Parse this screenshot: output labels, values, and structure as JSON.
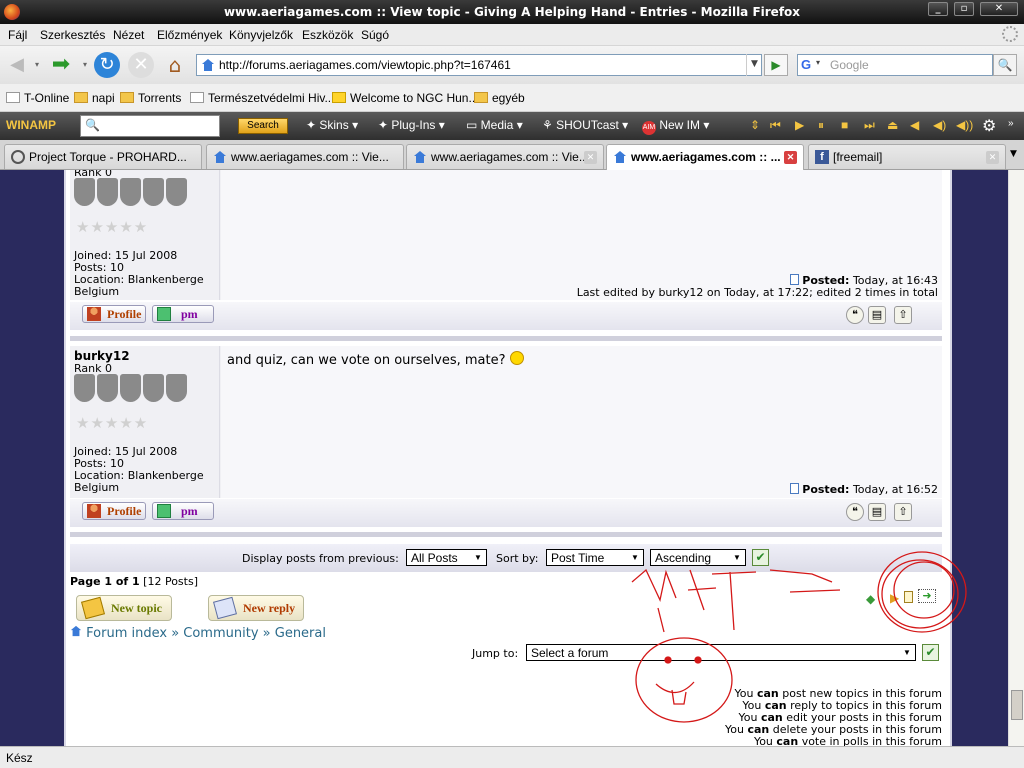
{
  "window": {
    "title": "www.aeriagames.com :: View topic - Giving A Helping Hand - Entries - Mozilla Firefox"
  },
  "menu": [
    "Fájl",
    "Szerkesztés",
    "Nézet",
    "Előzmények",
    "Könyvjelzők",
    "Eszközök",
    "Súgó"
  ],
  "nav": {
    "url": "http://forums.aeriagames.com/viewtopic.php?t=167461",
    "search_placeholder": "Google",
    "search_engine": "G"
  },
  "bookmarks": [
    "T-Online",
    "napi",
    "Torrents",
    "Természetvédelmi Hiv...",
    "Welcome to NGC Hun...",
    "egyéb"
  ],
  "winamp": {
    "logo": "WINAMP",
    "search_label": "Search",
    "items": [
      "Skins",
      "Plug-Ins",
      "Media",
      "SHOUTcast",
      "New IM"
    ]
  },
  "tabs": [
    {
      "label": "Project Torque - PROHARD..."
    },
    {
      "label": "www.aeriagames.com :: Vie..."
    },
    {
      "label": "www.aeriagames.com :: Vie..."
    },
    {
      "label": "www.aeriagames.com :: ..."
    },
    {
      "label": "[freemail]"
    }
  ],
  "posts": [
    {
      "rank": "Rank 0",
      "joined": "Joined: 15 Jul 2008",
      "posts": "Posts: 10",
      "location": "Location: Blankenberge",
      "country": "Belgium",
      "posted_label": "Posted:",
      "posted_time": "Today, at 16:43",
      "edited": "Last edited by burky12 on Today, at 17:22; edited 2 times in total",
      "profile_label": "Profile",
      "pm_label": "pm"
    },
    {
      "username": "burky12",
      "rank": "Rank 0",
      "message": "and quiz, can we vote on ourselves, mate?",
      "joined": "Joined: 15 Jul 2008",
      "posts": "Posts: 10",
      "location": "Location: Blankenberge",
      "country": "Belgium",
      "posted_label": "Posted:",
      "posted_time": "Today, at 16:52",
      "profile_label": "Profile",
      "pm_label": "pm"
    }
  ],
  "sort": {
    "display_label": "Display posts from previous:",
    "display_value": "All Posts",
    "sortby_label": "Sort by:",
    "sortby_value": "Post Time",
    "order_value": "Ascending"
  },
  "pagination": {
    "page": "Page 1 of 1",
    "count": "[12 Posts]"
  },
  "actions": {
    "new_topic": "New topic",
    "new_reply": "New reply"
  },
  "breadcrumb": [
    "Forum index",
    "Community",
    "General"
  ],
  "jump": {
    "label": "Jump to:",
    "value": "Select a forum"
  },
  "permissions": [
    {
      "pre": "You",
      "can": "can",
      "post": "post new topics in this forum"
    },
    {
      "pre": "You",
      "can": "can",
      "post": "reply to topics in this forum"
    },
    {
      "pre": "You",
      "can": "can",
      "post": "edit your posts in this forum"
    },
    {
      "pre": "You",
      "can": "can",
      "post": "delete your posts in this forum"
    },
    {
      "pre": "You",
      "can": "can",
      "post": "vote in polls in this forum"
    }
  ],
  "status": "Kész",
  "colors": {
    "page_bg": "#2a2a5e",
    "annotation_red": "#d41818"
  }
}
